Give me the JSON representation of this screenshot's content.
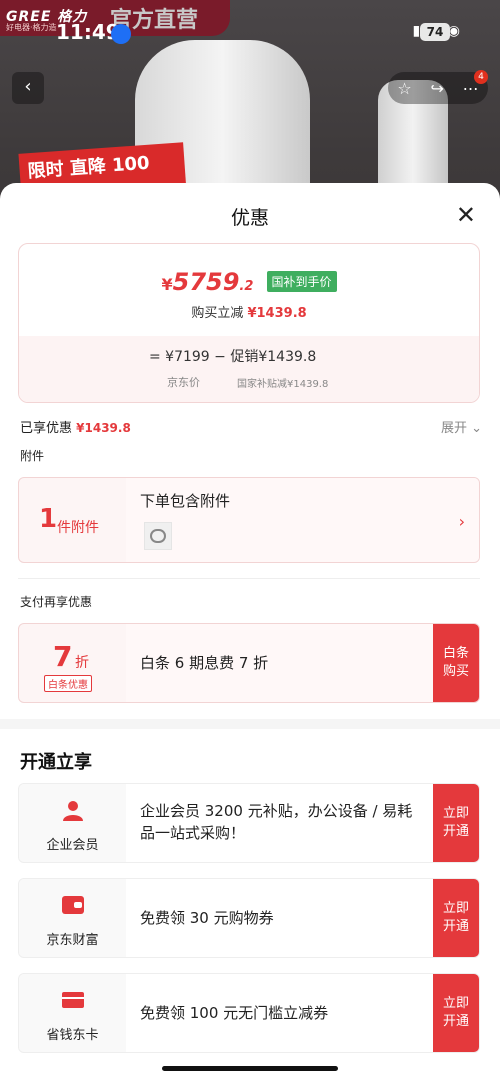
{
  "background": {
    "brand_logo": "GREE 格力",
    "brand_sub": "好电器·格力造",
    "brand_official": "官方直营",
    "promo_tag": "限时 直降 100"
  },
  "status_bar": {
    "time": "11:49",
    "battery": "74"
  },
  "nav": {
    "back_icon": "chevron-left-icon",
    "badge": "4"
  },
  "sheet": {
    "title": "优惠",
    "price": {
      "currency": "¥",
      "integer": "5759",
      "decimal": ".2",
      "tag": "国补到手价",
      "cut_label": "购买立减",
      "cut_value": "¥1439.8",
      "formula": "=  ¥7199  −  促销¥1439.8",
      "formula_sub1": "京东价",
      "formula_sub2": "国家补贴减¥1439.8"
    },
    "enjoyed": {
      "label": "已享优惠",
      "value": "¥1439.8",
      "expand": "展开 ⌄"
    },
    "accessory": {
      "section": "附件",
      "count": "1",
      "unit": "件附件",
      "title": "下单包含附件",
      "chevron": "›"
    },
    "pay": {
      "section": "支付再享优惠",
      "num": "7",
      "unit": "折",
      "tag": "白条优惠",
      "text": "白条 6 期息费 7 折",
      "button": "白条\n购买"
    },
    "open": {
      "title": "开通立享",
      "items": [
        {
          "label": "企业会员",
          "text": "企业会员 3200 元补贴，办公设备 / 易耗品一站式采购！",
          "button": "立即\n开通",
          "icon": "person-icon"
        },
        {
          "label": "京东财富",
          "text": "免费领 30 元购物券",
          "button": "立即\n开通",
          "icon": "wallet-icon"
        },
        {
          "label": "省钱东卡",
          "text": "免费领 100 元无门槛立减券",
          "button": "立即\n开通",
          "icon": "card-icon"
        }
      ]
    }
  },
  "colors": {
    "accent": "#e4393c",
    "green_tag": "#3fae5f"
  }
}
